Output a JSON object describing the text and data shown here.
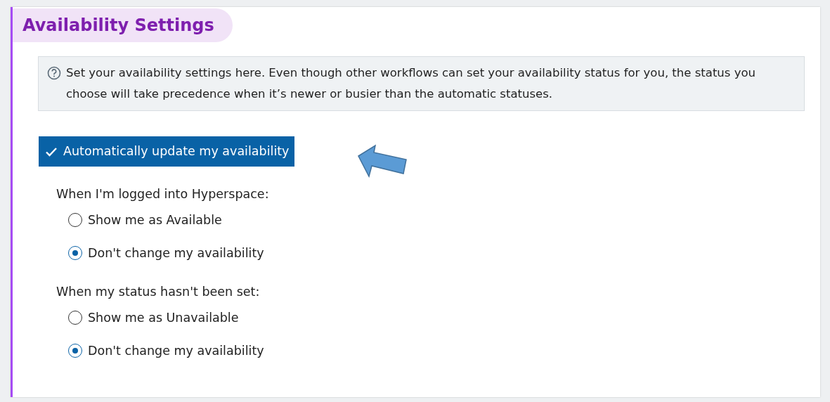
{
  "section": {
    "title": "Availability Settings"
  },
  "info": {
    "text": "Set your availability settings here. Even though other workflows can set your availability status for you, the status you choose will take precedence when it’s newer or busier than the automatic statuses."
  },
  "auto_update": {
    "label": "Automatically update my availability",
    "checked": true
  },
  "groups": [
    {
      "label": "When I'm logged into Hyperspace:",
      "options": [
        {
          "label": "Show me as Available",
          "selected": false
        },
        {
          "label": "Don't change my availability",
          "selected": true
        }
      ]
    },
    {
      "label": "When my status hasn't been set:",
      "options": [
        {
          "label": "Show me as Unavailable",
          "selected": false
        },
        {
          "label": "Don't change my availability",
          "selected": true
        }
      ]
    }
  ]
}
